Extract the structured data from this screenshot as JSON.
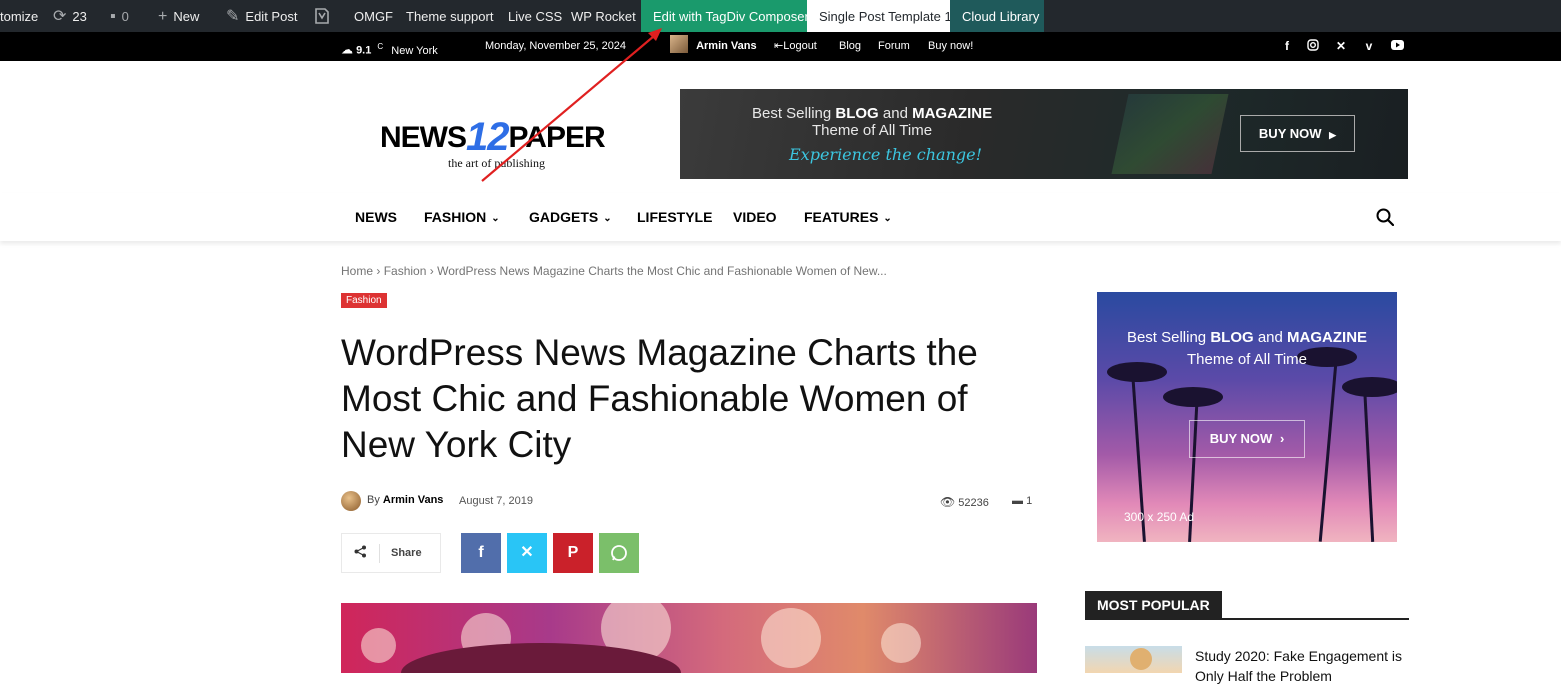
{
  "admin_bar": {
    "customize": "tomize",
    "updates_count": "23",
    "comments_count": "0",
    "new": "New",
    "edit_post": "Edit Post",
    "omgf": "OMGF",
    "theme_support": "Theme support",
    "live_css": "Live CSS",
    "wp_rocket": "WP Rocket",
    "edit_composer": "Edit with TagDiv Composer",
    "single_post_template": "Single Post Template 1",
    "cloud_library": "Cloud Library"
  },
  "top_bar": {
    "weather_temp": "9.1",
    "weather_unit": "C",
    "weather_city": "New York",
    "date": "Monday, November 25, 2024",
    "user": "Armin Vans",
    "logout": "Logout",
    "links": [
      "Blog",
      "Forum",
      "Buy now!"
    ],
    "social_icons": [
      "facebook-icon",
      "instagram-icon",
      "x-icon",
      "vimeo-icon",
      "youtube-icon"
    ]
  },
  "logo": {
    "part1": "NEWS",
    "part2": "12",
    "part3": "PAPER",
    "tagline": "the art of publishing"
  },
  "header_ad": {
    "line1_a": "Best Selling ",
    "line1_b": "BLOG",
    "line1_c": " and ",
    "line1_d": "MAGAZINE",
    "line2": "Theme of All Time",
    "line3": "Experience the change!",
    "button": "BUY NOW"
  },
  "nav": {
    "items": [
      "NEWS",
      "FASHION",
      "GADGETS",
      "LIFESTYLE",
      "VIDEO",
      "FEATURES"
    ]
  },
  "breadcrumb": {
    "home": "Home",
    "sep": "›",
    "category": "Fashion",
    "current": "WordPress News Magazine Charts the Most Chic and Fashionable Women of New..."
  },
  "post": {
    "category": "Fashion",
    "title": "WordPress News Magazine Charts the Most Chic and Fashionable Women of New York City",
    "by": "By",
    "author": "Armin Vans",
    "date": "August 7, 2019",
    "views": "52236",
    "comments": "1",
    "share_label": "Share"
  },
  "sidebar_ad": {
    "line1_a": "Best Selling ",
    "line1_b": "BLOG",
    "line1_c": " and ",
    "line1_d": "MAGAZINE",
    "line2": "Theme of All Time",
    "button": "BUY NOW",
    "size_label": "300 x 250 Ad"
  },
  "most_popular": {
    "heading": "MOST POPULAR",
    "first_title": "Study 2020: Fake Engagement is Only Half the Problem"
  },
  "colors": {
    "admin_bar": "#23282d",
    "composer_green": "#1a9a6c",
    "category_red": "#dd3333",
    "facebook": "#516eab",
    "twitter": "#29c5f6",
    "pinterest": "#ca212a",
    "whatsapp": "#7bbf6a",
    "annotation_arrow": "#e02020"
  }
}
